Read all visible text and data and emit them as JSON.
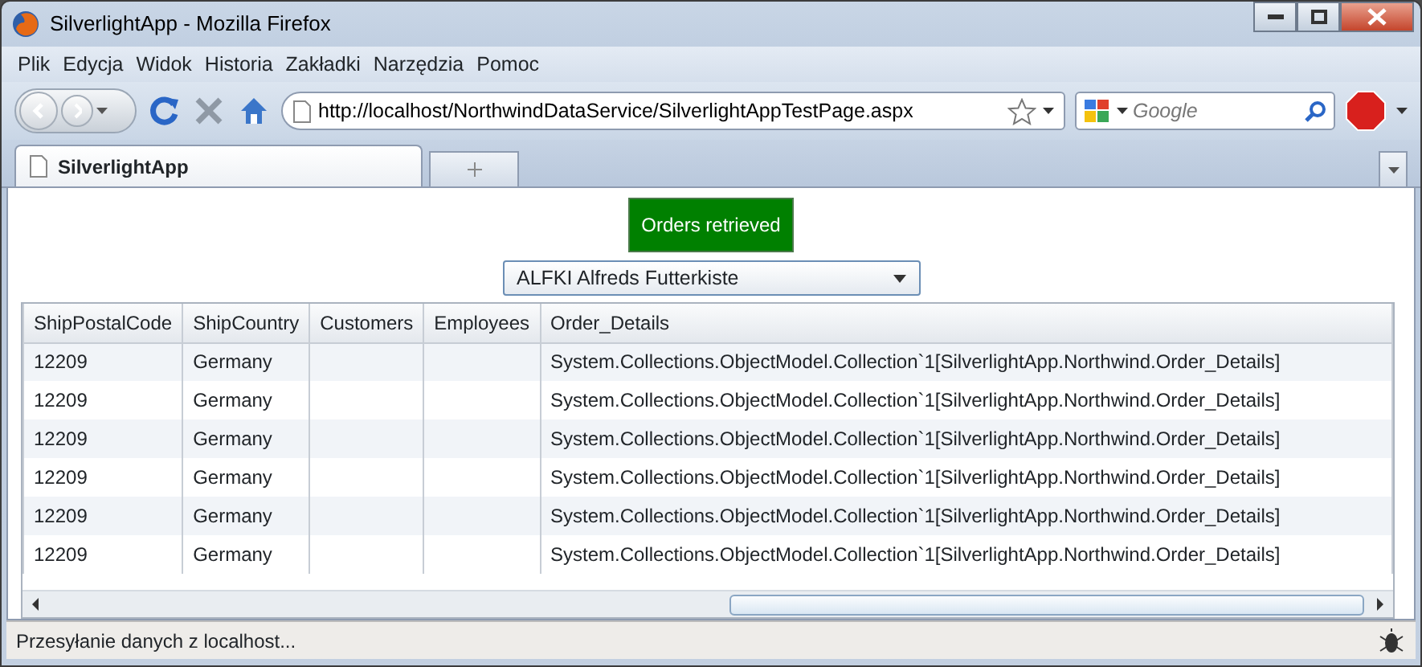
{
  "window": {
    "title": "SilverlightApp - Mozilla Firefox"
  },
  "menu": [
    "Plik",
    "Edycja",
    "Widok",
    "Historia",
    "Zakładki",
    "Narzędzia",
    "Pomoc"
  ],
  "address_bar": {
    "value": "http://localhost/NorthwindDataService/SilverlightAppTestPage.aspx"
  },
  "search": {
    "placeholder": "Google"
  },
  "tabs": [
    {
      "label": "SilverlightApp",
      "selected": true
    }
  ],
  "status_message": "Orders retrieved",
  "customer_select": {
    "value": "ALFKI  Alfreds Futterkiste"
  },
  "table": {
    "columns": [
      "ShipPostalCode",
      "ShipCountry",
      "Customers",
      "Employees",
      "Order_Details"
    ],
    "rows": [
      [
        "12209",
        "Germany",
        "",
        "",
        "System.Collections.ObjectModel.Collection`1[SilverlightApp.Northwind.Order_Details]"
      ],
      [
        "12209",
        "Germany",
        "",
        "",
        "System.Collections.ObjectModel.Collection`1[SilverlightApp.Northwind.Order_Details]"
      ],
      [
        "12209",
        "Germany",
        "",
        "",
        "System.Collections.ObjectModel.Collection`1[SilverlightApp.Northwind.Order_Details]"
      ],
      [
        "12209",
        "Germany",
        "",
        "",
        "System.Collections.ObjectModel.Collection`1[SilverlightApp.Northwind.Order_Details]"
      ],
      [
        "12209",
        "Germany",
        "",
        "",
        "System.Collections.ObjectModel.Collection`1[SilverlightApp.Northwind.Order_Details]"
      ],
      [
        "12209",
        "Germany",
        "",
        "",
        "System.Collections.ObjectModel.Collection`1[SilverlightApp.Northwind.Order_Details]"
      ]
    ]
  },
  "status_bar": "Przesyłanie danych z localhost..."
}
